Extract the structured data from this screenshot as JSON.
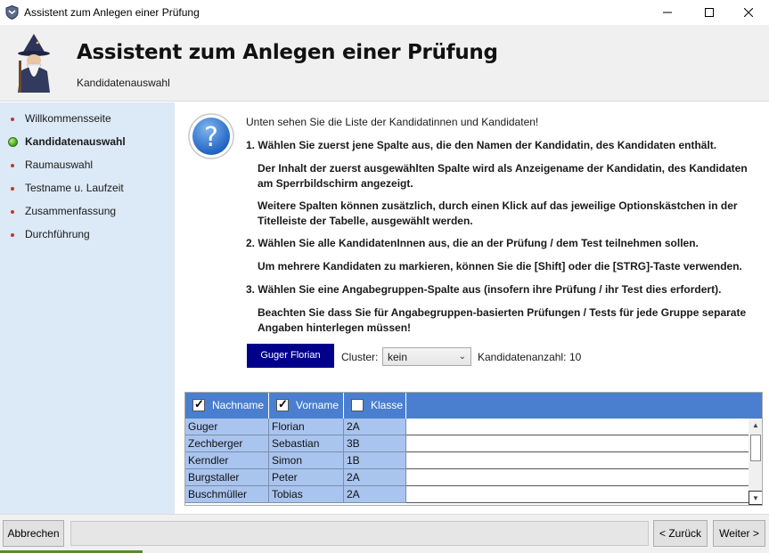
{
  "window": {
    "title": "Assistent zum Anlegen einer Prüfung",
    "controls": {
      "minimize": "–",
      "maximize": "☐",
      "close": "✕"
    }
  },
  "header": {
    "title": "Assistent zum Anlegen einer Prüfung",
    "subtitle": "Kandidatenauswahl",
    "icon": "wizard-icon"
  },
  "sidebar": {
    "items": [
      {
        "label": "Willkommensseite",
        "active": false
      },
      {
        "label": "Kandidatenauswahl",
        "active": true
      },
      {
        "label": "Raumauswahl",
        "active": false
      },
      {
        "label": "Testname u. Laufzeit",
        "active": false
      },
      {
        "label": "Zusammenfassung",
        "active": false
      },
      {
        "label": "Durchführung",
        "active": false
      }
    ]
  },
  "main": {
    "intro": "Unten sehen Sie die Liste der Kandidatinnen und Kandidaten!",
    "instructions": {
      "step1": "1. Wählen Sie zuerst jene Spalte aus, die den Namen der Kandidatin, des Kandidaten enthält.",
      "step1_note1": "Der Inhalt der zuerst ausgewählten Spalte wird als Anzeigename der Kandidatin, des Kandidaten am Sperrbildschirm angezeigt.",
      "step1_note2": "Weitere Spalten können zusätzlich, durch einen Klick auf das jeweilige Optionskästchen in der Titelleiste der Tabelle, ausgewählt werden.",
      "step2": "2. Wählen Sie alle KandidatenInnen aus, die an der Prüfung / dem Test teilnehmen sollen.",
      "step2_note": "Um mehrere Kandidaten zu markieren, können Sie die [Shift] oder die [STRG]-Taste verwenden.",
      "step3": "3. Wählen Sie eine Angabegruppen-Spalte aus (insofern ihre Prüfung / ihr Test dies erfordert).",
      "step3_note": "Beachten Sie dass Sie für Angabegruppen-basierten Prüfungen / Tests für jede Gruppe separate Angaben hinterlegen müssen!"
    },
    "candidate_button": "Guger Florian",
    "cluster": {
      "label": "Cluster:",
      "selected": "kein"
    },
    "count": {
      "label": "Kandidatenanzahl:",
      "value": "10"
    },
    "table": {
      "columns": [
        {
          "label": "Nachname",
          "checked": true
        },
        {
          "label": "Vorname",
          "checked": true
        },
        {
          "label": "Klasse",
          "checked": false
        }
      ],
      "rows": [
        [
          "Guger",
          "Florian",
          "2A"
        ],
        [
          "Zechberger",
          "Sebastian",
          "3B"
        ],
        [
          "Kerndler",
          "Simon",
          "1B"
        ],
        [
          "Burgstaller",
          "Peter",
          "2A"
        ],
        [
          "Buschmüller",
          "Tobias",
          "2A"
        ]
      ]
    }
  },
  "footer": {
    "cancel": "Abbrechen",
    "back": "< Zurück",
    "next": "Weiter >"
  },
  "colors": {
    "header_bg": "#f0f0f0",
    "sidebar_bg": "#dce9f6",
    "table_header": "#4a7fd0",
    "table_cell": "#a9c4ee",
    "primary_button": "#00008b",
    "active_bullet": "#3f9c1f",
    "inactive_bullet": "#c0392b"
  }
}
